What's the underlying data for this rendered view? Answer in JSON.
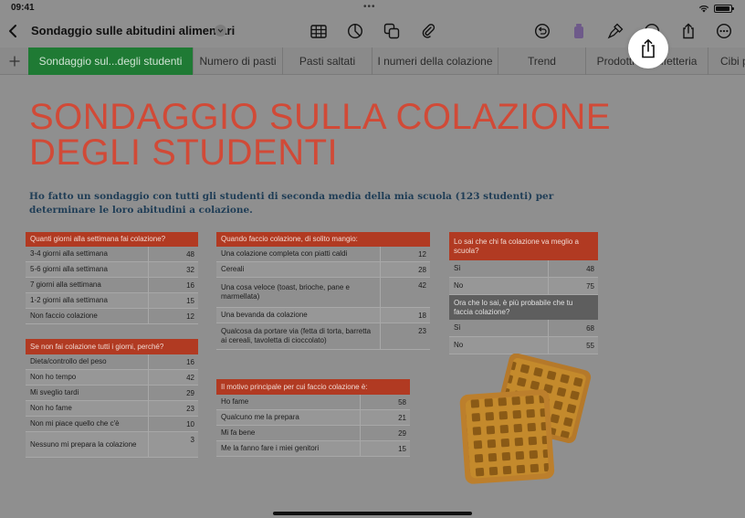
{
  "status": {
    "time": "09:41",
    "dots": "•••"
  },
  "doc": {
    "title": "Sondaggio sulle abitudini alimentari"
  },
  "tabs": [
    {
      "label": "Sondaggio sul...degli studenti"
    },
    {
      "label": "Numero di pasti"
    },
    {
      "label": "Pasti saltati"
    },
    {
      "label": "I numeri della colazione"
    },
    {
      "label": "Trend"
    },
    {
      "label": "Prodotti in caffetteria"
    },
    {
      "label": "Cibi p"
    }
  ],
  "sheet": {
    "title": "SONDAGGIO SULLA COLAZIONE DEGLI STUDENTI",
    "subtitle": "Ho fatto un sondaggio con tutti gli studenti di seconda media della mia scuola (123 studenti) per determinare le loro abitudini a colazione."
  },
  "tables": {
    "giorni": {
      "header": "Quanti giorni alla settimana fai colazione?",
      "rows": [
        {
          "label": "3-4 giorni alla settimana",
          "value": "48"
        },
        {
          "label": "5-6 giorni alla settimana",
          "value": "32"
        },
        {
          "label": "7 giorni alla settimana",
          "value": "16"
        },
        {
          "label": "1-2 giorni alla settimana",
          "value": "15"
        },
        {
          "label": "Non faccio colazione",
          "value": "12"
        }
      ]
    },
    "perche": {
      "header": "Se non fai colazione tutti i giorni, perché?",
      "rows": [
        {
          "label": "Dieta/controllo del peso",
          "value": "16"
        },
        {
          "label": "Non ho tempo",
          "value": "42"
        },
        {
          "label": "Mi sveglio tardi",
          "value": "29"
        },
        {
          "label": "Non ho fame",
          "value": "23"
        },
        {
          "label": "Non mi piace quello che c'è",
          "value": "10"
        },
        {
          "label": "Nessuno mi prepara la colazione",
          "value": "3"
        }
      ]
    },
    "mangio": {
      "header": "Quando faccio colazione, di solito mangio:",
      "rows": [
        {
          "label": "Una colazione completa con piatti caldi",
          "value": "12"
        },
        {
          "label": "Cereali",
          "value": "28"
        },
        {
          "label": "Una cosa veloce (toast, brioche, pane e marmellata)",
          "value": "42"
        },
        {
          "label": "Una bevanda da colazione",
          "value": "18"
        },
        {
          "label": "Qualcosa da portare via (fetta di torta, barretta ai cereali, tavoletta di cioccolato)",
          "value": "23"
        }
      ]
    },
    "motivo": {
      "header": "Il motivo principale per cui faccio colazione è:",
      "rows": [
        {
          "label": "Ho fame",
          "value": "58"
        },
        {
          "label": "Qualcuno me la prepara",
          "value": "21"
        },
        {
          "label": "Mi fa bene",
          "value": "29"
        },
        {
          "label": "Me la fanno fare i miei genitori",
          "value": "15"
        }
      ]
    },
    "meglio": {
      "header": "Lo sai che chi fa colazione va meglio a scuola?",
      "rows": [
        {
          "label": "Sì",
          "value": "48"
        },
        {
          "label": "No",
          "value": "75"
        }
      ]
    },
    "probabile": {
      "header": "Ora che lo sai, è più probabile che tu faccia colazione?",
      "rows": [
        {
          "label": "Sì",
          "value": "68"
        },
        {
          "label": "No",
          "value": "55"
        }
      ]
    }
  },
  "colors": {
    "accent": "#d14a37",
    "header_red": "#b13a22",
    "active_tab": "#1f7a34",
    "subtitle": "#1f3d56"
  }
}
